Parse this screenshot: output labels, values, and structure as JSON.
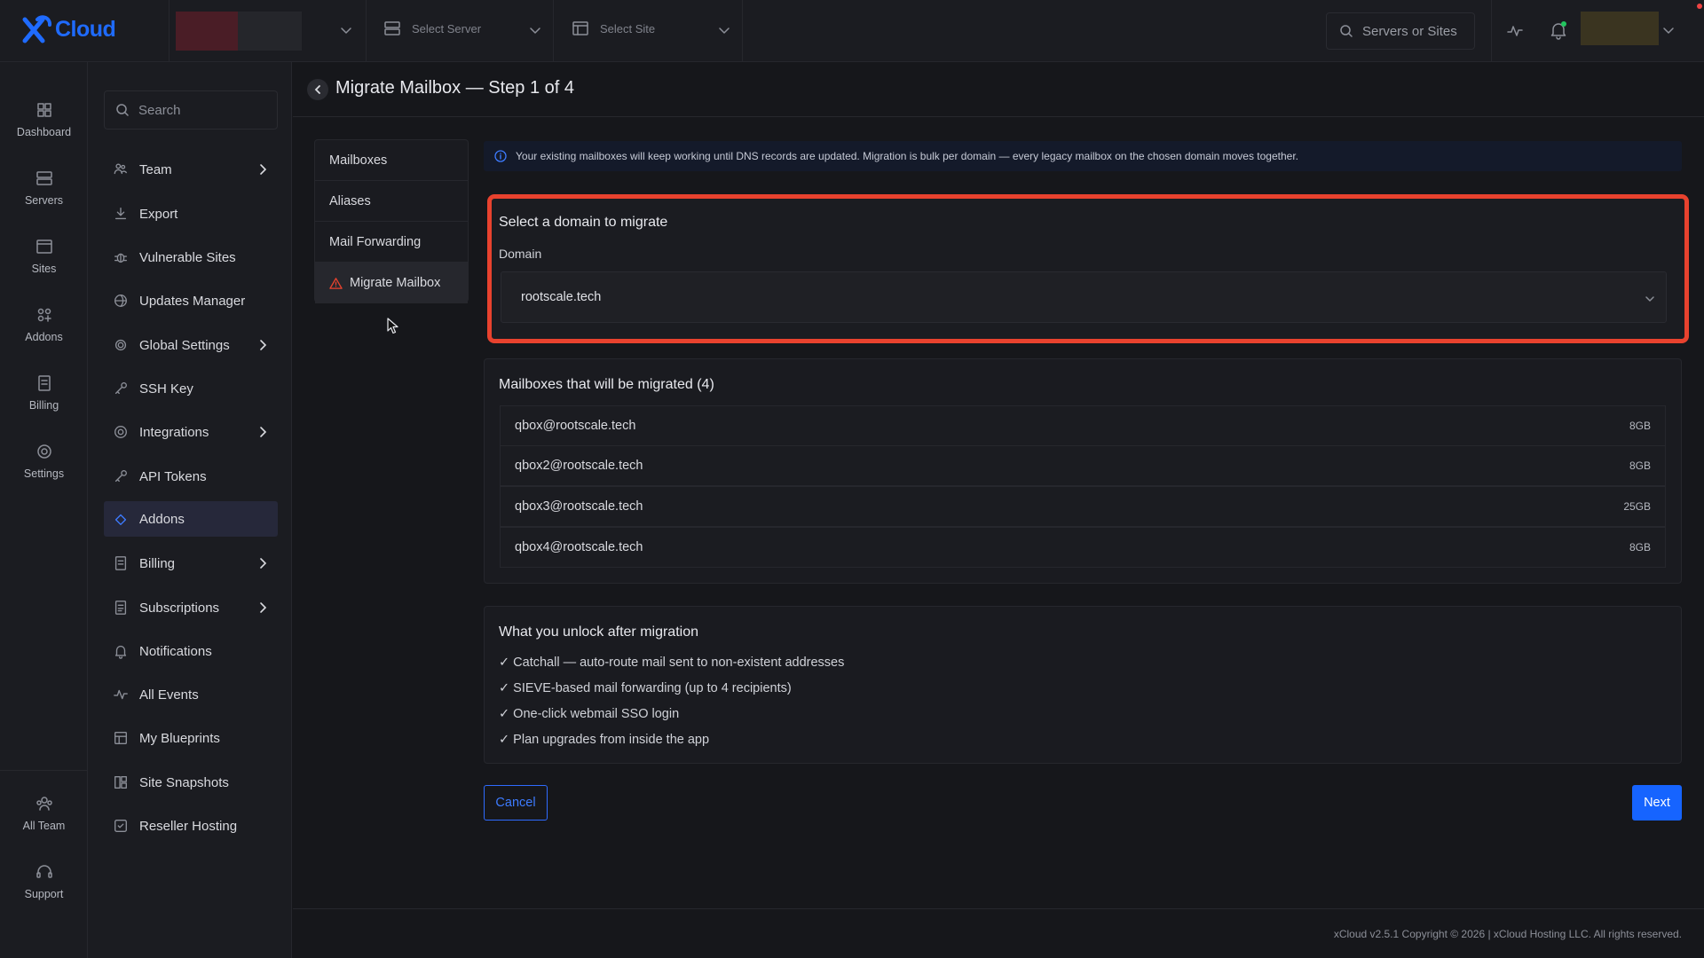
{
  "app": {
    "brand": "Cloud",
    "brand_color": "#1f6bff"
  },
  "topbar": {
    "server_placeholder": "Select Server",
    "site_placeholder": "Select Site",
    "search_placeholder": "Servers or Sites"
  },
  "rail": {
    "items": [
      {
        "label": "Dashboard",
        "icon": "dashboard-icon"
      },
      {
        "label": "Servers",
        "icon": "server-icon"
      },
      {
        "label": "Sites",
        "icon": "sites-icon"
      },
      {
        "label": "Addons",
        "icon": "addons-icon"
      },
      {
        "label": "Billing",
        "icon": "billing-icon"
      },
      {
        "label": "Settings",
        "icon": "settings-icon"
      }
    ],
    "bottom": [
      {
        "label": "All Team",
        "icon": "team-icon"
      },
      {
        "label": "Support",
        "icon": "support-icon"
      }
    ]
  },
  "sidemenu": {
    "search_placeholder": "Search",
    "items": [
      {
        "label": "Team",
        "has_children": true
      },
      {
        "label": "Export",
        "has_children": false
      },
      {
        "label": "Vulnerable Sites",
        "has_children": false
      },
      {
        "label": "Updates Manager",
        "has_children": false
      },
      {
        "label": "Global Settings",
        "has_children": true
      },
      {
        "label": "SSH Key",
        "has_children": false
      },
      {
        "label": "Integrations",
        "has_children": true
      },
      {
        "label": "API Tokens",
        "has_children": false
      },
      {
        "label": "Addons",
        "has_children": false,
        "active": true
      },
      {
        "label": "Billing",
        "has_children": true
      },
      {
        "label": "Subscriptions",
        "has_children": true
      },
      {
        "label": "Notifications",
        "has_children": false
      },
      {
        "label": "All Events",
        "has_children": false
      },
      {
        "label": "My Blueprints",
        "has_children": false
      },
      {
        "label": "Site Snapshots",
        "has_children": false
      },
      {
        "label": "Reseller Hosting",
        "has_children": false
      }
    ]
  },
  "page": {
    "title": "Migrate Mailbox — Step 1 of 4"
  },
  "subnav": {
    "items": [
      "Mailboxes",
      "Aliases",
      "Mail Forwarding",
      "Migrate Mailbox"
    ],
    "active_index": 3
  },
  "info": {
    "text": "Your existing mailboxes will keep working until DNS records are updated. Migration is bulk per domain — every legacy mailbox on the chosen domain moves together."
  },
  "domain_card": {
    "title": "Select a domain to migrate",
    "field_label": "Domain",
    "selected": "rootscale.tech",
    "highlight_color": "#e8422e"
  },
  "mailboxes": {
    "title": "Mailboxes that will be migrated (4)",
    "rows": [
      {
        "address": "qbox@rootscale.tech",
        "size": "8GB"
      },
      {
        "address": "qbox2@rootscale.tech",
        "size": "8GB"
      },
      {
        "address": "qbox3@rootscale.tech",
        "size": "25GB"
      },
      {
        "address": "qbox4@rootscale.tech",
        "size": "8GB"
      }
    ]
  },
  "unlock": {
    "title": "What you unlock after migration",
    "items": [
      "✓ Catchall — auto-route mail sent to non-existent addresses",
      "✓ SIEVE-based mail forwarding (up to 4 recipients)",
      "✓ One-click webmail SSO login",
      "✓ Plan upgrades from inside the app"
    ]
  },
  "actions": {
    "cancel": "Cancel",
    "next": "Next"
  },
  "footer": {
    "text": "xCloud v2.5.1 Copyright © 2026 | xCloud Hosting LLC. All rights reserved."
  }
}
